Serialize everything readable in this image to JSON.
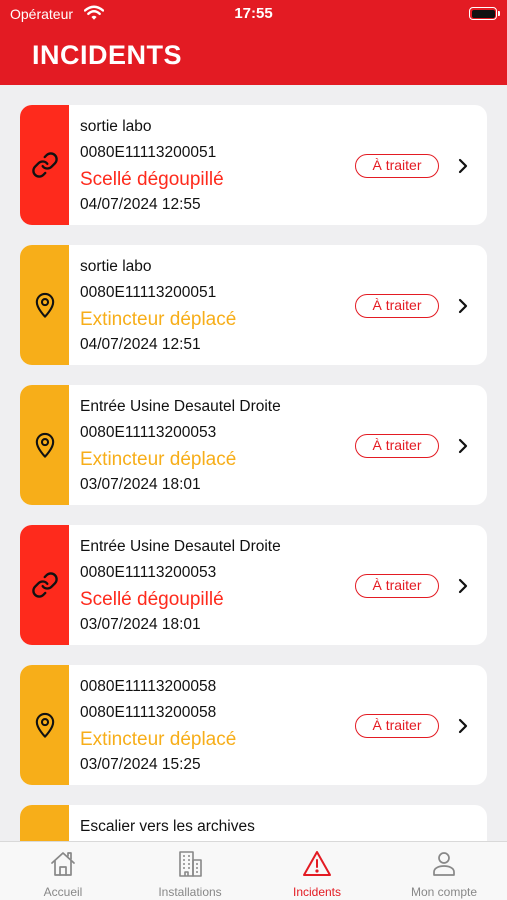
{
  "status_bar": {
    "carrier": "Opérateur",
    "time": "17:55"
  },
  "header": {
    "title": "INCIDENTS"
  },
  "colors": {
    "brand_red": "#e31b23",
    "alert_red": "#fe2a1c",
    "warning_yellow": "#f7ae19"
  },
  "incidents": [
    {
      "location": "sortie labo",
      "device_id": "0080E11113200051",
      "type": "Scellé dégoupillé",
      "datetime": "04/07/2024 12:55",
      "status": "À traiter",
      "icon": "link-icon",
      "severity_color": "#fe2a1c"
    },
    {
      "location": "sortie labo",
      "device_id": "0080E11113200051",
      "type": "Extincteur déplacé",
      "datetime": "04/07/2024 12:51",
      "status": "À traiter",
      "icon": "location-pin-icon",
      "severity_color": "#f7ae19"
    },
    {
      "location": "Entrée Usine Desautel Droite",
      "device_id": "0080E11113200053",
      "type": "Extincteur déplacé",
      "datetime": "03/07/2024 18:01",
      "status": "À traiter",
      "icon": "location-pin-icon",
      "severity_color": "#f7ae19"
    },
    {
      "location": "Entrée Usine Desautel Droite",
      "device_id": "0080E11113200053",
      "type": "Scellé dégoupillé",
      "datetime": "03/07/2024 18:01",
      "status": "À traiter",
      "icon": "link-icon",
      "severity_color": "#fe2a1c"
    },
    {
      "location": "0080E11113200058",
      "device_id": "0080E11113200058",
      "type": "Extincteur déplacé",
      "datetime": "03/07/2024 15:25",
      "status": "À traiter",
      "icon": "location-pin-icon",
      "severity_color": "#f7ae19"
    },
    {
      "location": "Escalier vers les archives",
      "icon": "location-pin-icon",
      "severity_color": "#f7ae19"
    }
  ],
  "tab_bar": {
    "tabs": [
      {
        "label": "Accueil",
        "icon": "home-icon"
      },
      {
        "label": "Installations",
        "icon": "building-icon"
      },
      {
        "label": "Incidents",
        "icon": "warning-icon",
        "active": true
      },
      {
        "label": "Mon compte",
        "icon": "user-icon"
      }
    ]
  }
}
